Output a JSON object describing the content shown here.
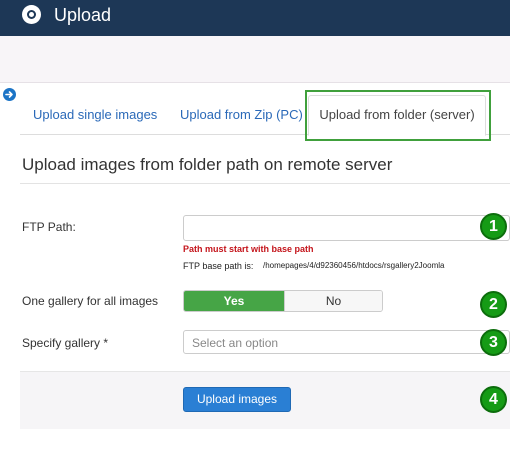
{
  "header": {
    "title": "Upload",
    "logo_icon": "joomla-logo-icon"
  },
  "sidebar_toggle": {
    "icon": "arrow-right-circle-icon"
  },
  "tabs": [
    {
      "label": "Upload single images",
      "active": false
    },
    {
      "label": "Upload from Zip (PC)",
      "active": false
    },
    {
      "label": "Upload from folder (server)",
      "active": true
    }
  ],
  "section": {
    "title": "Upload images from folder path on remote server"
  },
  "form": {
    "ftp_path": {
      "label": "FTP Path:",
      "value": "",
      "error": "Path must start with base path",
      "base_path_label": "FTP base path is:",
      "base_path_value": "/homepages/4/d92360456/htdocs/rsgallery2Joomla"
    },
    "one_gallery": {
      "label": "One gallery for all images",
      "yes": "Yes",
      "no": "No",
      "selected": "Yes"
    },
    "specify_gallery": {
      "label": "Specify gallery *",
      "placeholder": "Select an option"
    }
  },
  "actions": {
    "upload_label": "Upload images"
  },
  "markers": [
    "1",
    "2",
    "3",
    "4"
  ],
  "colors": {
    "header_bg": "#1d3756",
    "active_yes": "#46a546",
    "primary_button": "#2a7fd4",
    "error": "#c4141b",
    "marker": "#159b15",
    "highlight_border": "#40a03c"
  }
}
